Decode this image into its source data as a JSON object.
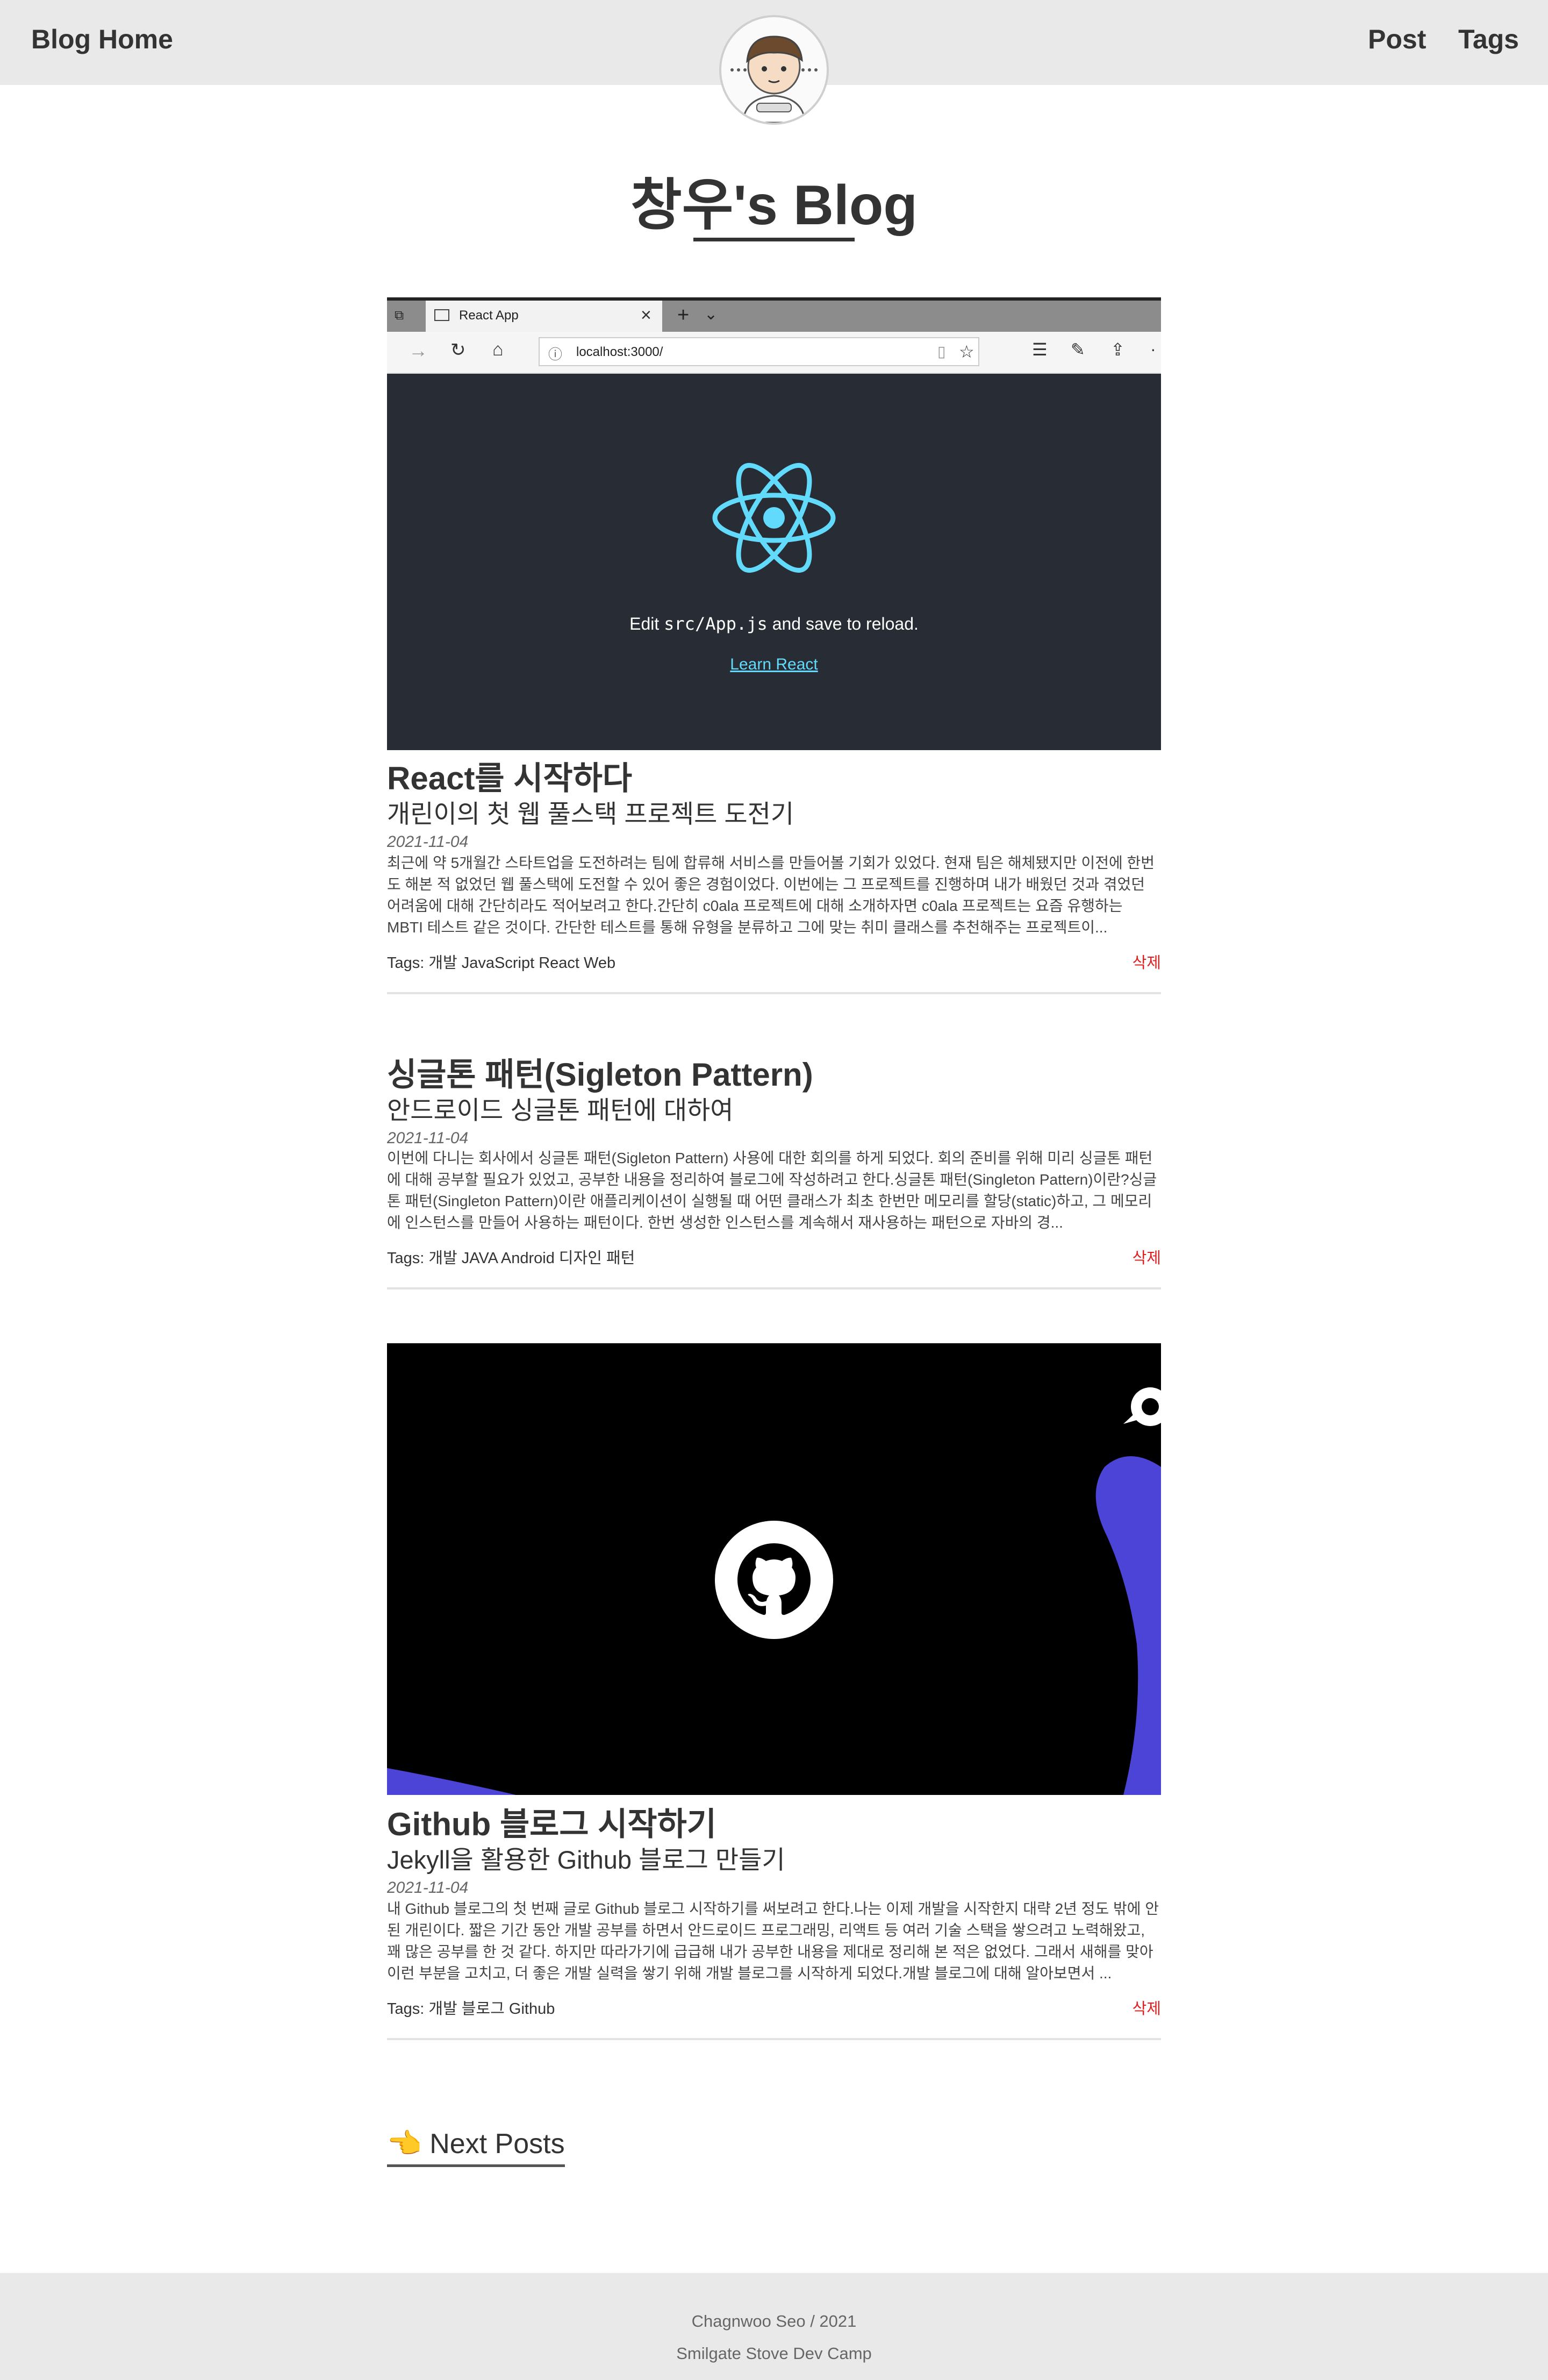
{
  "header": {
    "brand": "Blog Home",
    "nav": [
      "Post",
      "Tags"
    ]
  },
  "site_title": "창우's Blog",
  "posts": [
    {
      "title": "React를 시작하다",
      "subtitle": "개린이의 첫 웹 풀스택 프로젝트 도전기",
      "date": "2021-11-04",
      "body": "최근에 약 5개월간 스타트업을 도전하려는 팀에 합류해 서비스를 만들어볼 기회가 있었다. 현재 팀은 해체됐지만 이전에 한번도 해본 적 없었던 웹 풀스택에 도전할 수 있어 좋은 경험이었다. 이번에는 그 프로젝트를 진행하며 내가 배웠던 것과 겪었던 어려움에 대해 간단히라도 적어보려고 한다.간단히 c0ala 프로젝트에 대해 소개하자면 c0ala 프로젝트는 요즘 유행하는 MBTI 테스트 같은 것이다. 간단한 테스트를 통해 유형을 분류하고 그에 맞는 취미 클래스를 추천해주는 프로젝트이...",
      "tags": "Tags: 개발 JavaScript React Web",
      "delete_label": "삭제",
      "thumb": {
        "tab_title": "React App",
        "url": "localhost:3000/",
        "edit_text_prefix": "Edit ",
        "edit_code": "src/App.js",
        "edit_text_suffix": " and save to reload.",
        "learn_link": "Learn React"
      }
    },
    {
      "title": "싱글톤 패턴(Sigleton Pattern)",
      "subtitle": "안드로이드 싱글톤 패턴에 대하여",
      "date": "2021-11-04",
      "body": "이번에 다니는 회사에서 싱글톤 패턴(Sigleton Pattern) 사용에 대한 회의를 하게 되었다. 회의 준비를 위해 미리 싱글톤 패턴에 대해 공부할 필요가 있었고, 공부한 내용을 정리하여 블로그에 작성하려고 한다.싱글톤 패턴(Singleton Pattern)이란?싱글톤 패턴(Singleton Pattern)이란 애플리케이션이 실행될 때 어떤 클래스가 최초 한번만 메모리를 할당(static)하고, 그 메모리에 인스턴스를 만들어 사용하는 패턴이다. 한번 생성한 인스턴스를 계속해서 재사용하는 패턴으로 자바의 경...",
      "tags": "Tags: 개발 JAVA Android 디자인 패턴",
      "delete_label": "삭제"
    },
    {
      "title": "Github 블로그 시작하기",
      "subtitle": "Jekyll을 활용한 Github 블로그 만들기",
      "date": "2021-11-04",
      "body": "내 Github 블로그의 첫 번째 글로 Github 블로그 시작하기를 써보려고 한다.나는 이제 개발을 시작한지 대략 2년 정도 밖에 안된 개린이다. 짧은 기간 동안 개발 공부를 하면서 안드로이드 프로그래밍, 리액트 등 여러 기술 스택을 쌓으려고 노력해왔고, 꽤 많은 공부를 한 것 같다. 하지만 따라가기에 급급해 내가 공부한 내용을 제대로 정리해 본 적은 없었다. 그래서 새해를 맞아 이런 부분을 고치고, 더 좋은 개발 실력을 쌓기 위해 개발 블로그를 시작하게 되었다.개발 블로그에 대해 알아보면서 ...",
      "tags": "Tags: 개발 블로그 Github",
      "delete_label": "삭제"
    }
  ],
  "next_posts": "👈 Next Posts",
  "footer": {
    "line1": "Chagnwoo Seo / 2021",
    "line2": "Smilgate Stove Dev Camp"
  },
  "colors": {
    "header_bg": "#e9e9e9",
    "react_bg": "#282c34",
    "react_blue": "#61dafb",
    "delete_red": "#e02020",
    "github_purple": "#4b44d6"
  }
}
